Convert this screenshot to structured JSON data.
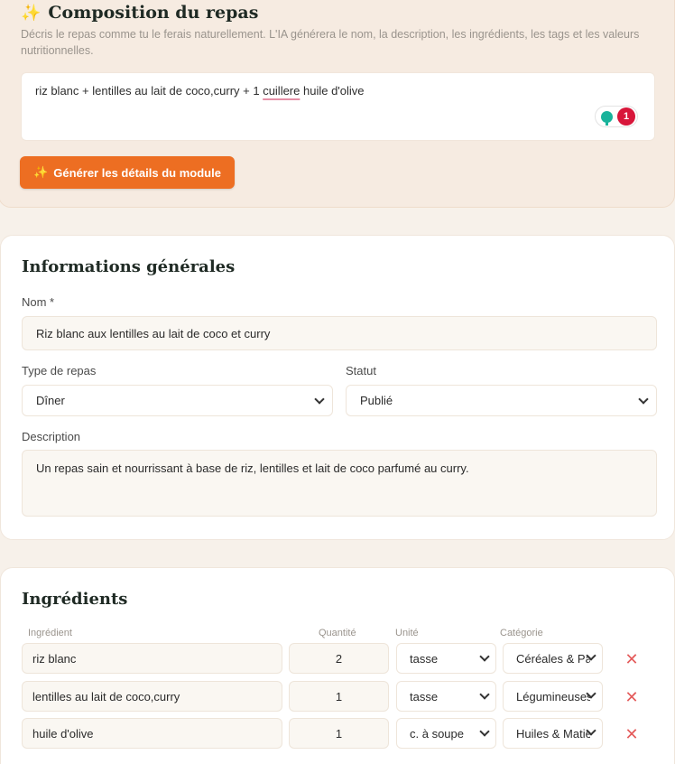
{
  "compose": {
    "title": "Composition du repas",
    "description": "Décris le repas comme tu le ferais naturellement. L'IA générera le nom, la description, les ingrédients, les tags et les valeurs nutritionnelles.",
    "input_before": "riz blanc + lentilles au lait de coco,curry + 1 ",
    "input_underlined": "cuillere",
    "input_after": " huile d'olive",
    "grammar_count": "1",
    "generate_button": "Générer les détails du module"
  },
  "info": {
    "title": "Informations générales",
    "name_label": "Nom *",
    "name_value": "Riz blanc aux lentilles au lait de coco et curry",
    "meal_type_label": "Type de repas",
    "meal_type_value": "Dîner",
    "status_label": "Statut",
    "status_value": "Publié",
    "description_label": "Description",
    "description_value": "Un repas sain et nourrissant à base de riz, lentilles et lait de coco parfumé au curry."
  },
  "ingredients": {
    "title": "Ingrédients",
    "headers": {
      "ingredient": "Ingrédient",
      "quantity": "Quantité",
      "unit": "Unité",
      "category": "Catégorie"
    },
    "rows": [
      {
        "name": "riz blanc",
        "quantity": "2",
        "unit": "tasse",
        "category": "Céréales & Pâtes"
      },
      {
        "name": "lentilles au lait de coco,curry",
        "quantity": "1",
        "unit": "tasse",
        "category": "Légumineuses"
      },
      {
        "name": "huile d'olive",
        "quantity": "1",
        "unit": "c. à soupe",
        "category": "Huiles & Matières grasses"
      }
    ]
  },
  "colors": {
    "accent": "#ed6e22",
    "delete": "#e45b5b",
    "grammar": "#d8163a"
  },
  "icons": {
    "sparkle": "sparkle-icon",
    "bulb": "lightbulb-icon",
    "delete": "close-icon",
    "chevron": "chevron-down-icon"
  }
}
